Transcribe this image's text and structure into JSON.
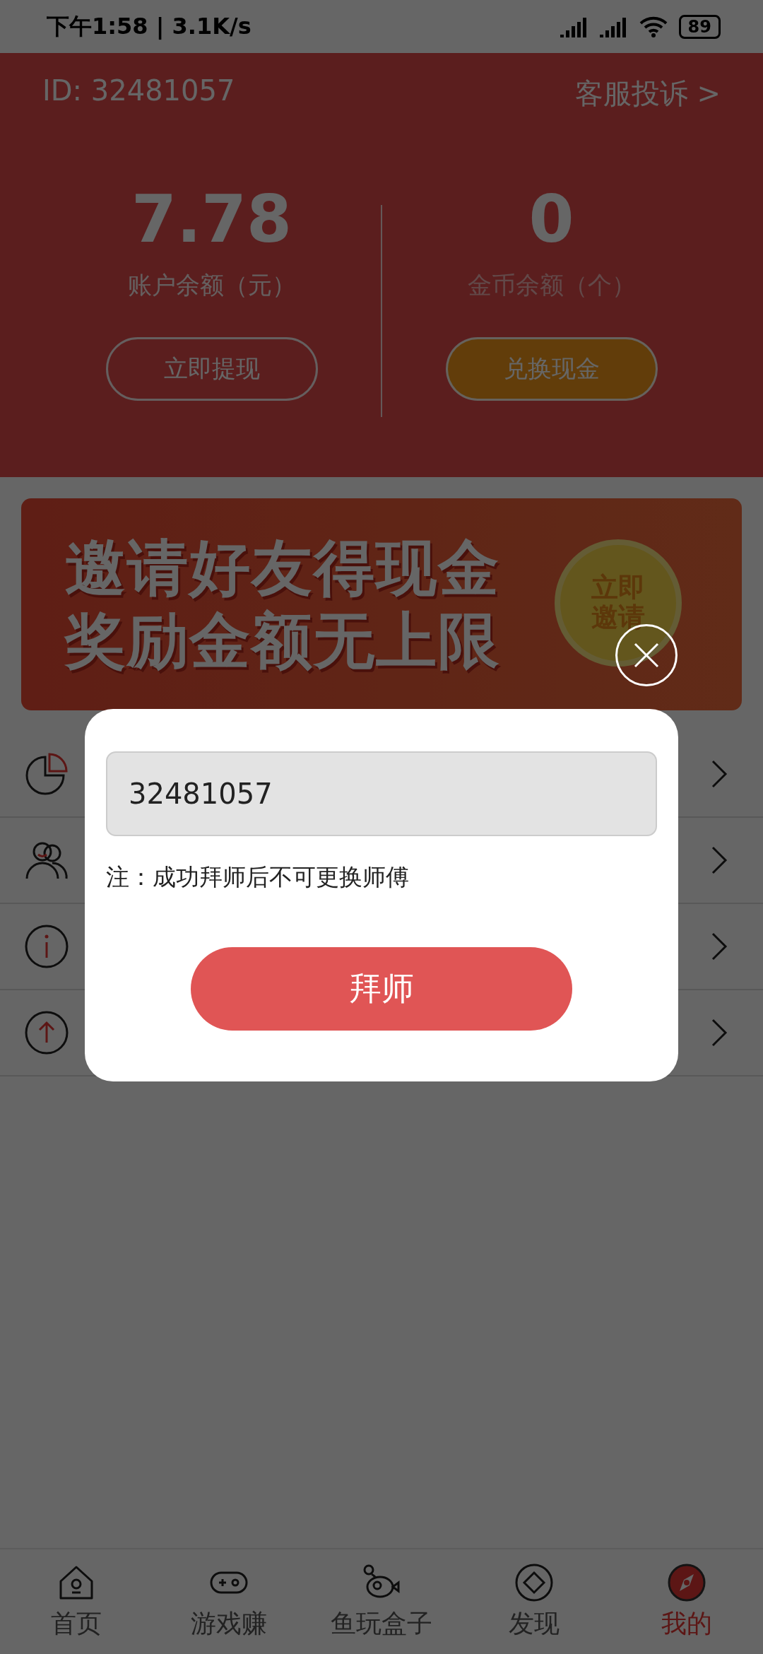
{
  "status_bar": {
    "time": "下午1:58 | 3.1K/s",
    "battery": "89"
  },
  "header": {
    "user_id": "ID: 32481057",
    "complaint_link": "客服投诉 >",
    "balances": [
      {
        "amount": "7.78",
        "label": "账户余额（元）",
        "button": "立即提现",
        "kind": "outline"
      },
      {
        "amount": "0",
        "label": "金币余额（个）",
        "button": "兑换现金",
        "kind": "filled"
      }
    ]
  },
  "banner": {
    "lines": [
      "邀请好友得现金",
      "奖励金额无上限"
    ],
    "badge": "立即邀请"
  },
  "menu_rows": [
    {
      "kind": "pie"
    },
    {
      "kind": "users"
    },
    {
      "kind": "info"
    },
    {
      "kind": "upload"
    }
  ],
  "dialog": {
    "value": "32481057",
    "note": "注：成功拜师后不可更换师傅",
    "button": "拜师"
  },
  "tab_bar": [
    {
      "label": "首页",
      "kind": "home",
      "selected": false
    },
    {
      "label": "游戏赚",
      "kind": "game",
      "selected": false
    },
    {
      "label": "鱼玩盒子",
      "kind": "fish",
      "selected": false
    },
    {
      "label": "发现",
      "kind": "discover",
      "selected": false
    },
    {
      "label": "我的",
      "kind": "me",
      "selected": true
    }
  ]
}
